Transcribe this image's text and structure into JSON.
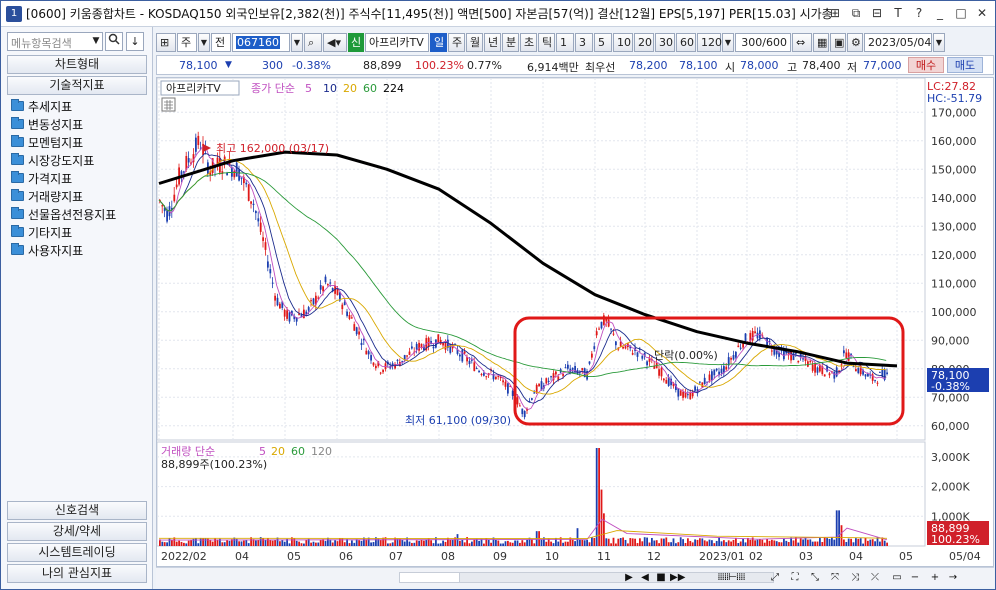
{
  "window": {
    "app_icon": "1",
    "title": "[0600] 키움종합차트 - KOSDAQ150 외국인보유[2,382(천)] 주식수[11,495(천)] 액면[500] 자본금[57(억)] 결산[12월] EPS[5,197] PER[15.03] 시가총",
    "buttons": [
      "⊞",
      "⧉",
      "⊟",
      "T",
      "?",
      "_",
      "□",
      "✕"
    ]
  },
  "left_panel": {
    "search_placeholder": "메뉴항목검색",
    "sections_top": [
      "차트형태",
      "기술적지표"
    ],
    "folders": [
      "추세지표",
      "변동성지표",
      "모멘텀지표",
      "시장강도지표",
      "가격지표",
      "거래량지표",
      "선물옵션전용지표",
      "기타지표",
      "사용자지표"
    ],
    "sections_bottom": [
      "신호검색",
      "강세/약세",
      "시스템트레이딩",
      "나의 관심지표"
    ]
  },
  "toolbar": {
    "type": "주",
    "prefix": "전",
    "code": "067160",
    "new_badge": "신",
    "name": "아프리카TV",
    "periods": [
      "일",
      "주",
      "월",
      "년",
      "분",
      "초",
      "틱"
    ],
    "active_period": "일",
    "intervals": [
      "1",
      "3",
      "5",
      "10",
      "20",
      "30",
      "60",
      "120"
    ],
    "count": "300/600",
    "date": "2023/05/04"
  },
  "quote": {
    "price": "78,100",
    "change": "300",
    "change_pct": "-0.38%",
    "volume": "88,899",
    "volume_ratio": "100.23%",
    "turnover": "0.77%",
    "amount": "6,914백만",
    "best_ask_label": "최우선",
    "best_ask": "78,200",
    "best_bid": "78,100",
    "open_label": "시",
    "open": "78,000",
    "high_label": "고",
    "high": "78,400",
    "low_label": "저",
    "low": "77,000",
    "buy": "매수",
    "sell": "매도"
  },
  "price_panel": {
    "title": "아프리카TV",
    "ma_label": "종가 단순",
    "ma_periods": [
      "5",
      "10",
      "20",
      "60",
      "224"
    ],
    "ma_colors": [
      "#c04fc0",
      "#1a2a8c",
      "#d9a800",
      "#2a9a3a",
      "#000000"
    ],
    "lc": "LC:27.82",
    "hc": "HC:-51.79",
    "y_ticks": [
      "170,000",
      "160,000",
      "150,000",
      "140,000",
      "130,000",
      "120,000",
      "110,000",
      "100,000",
      "90,000",
      "80,000",
      "70,000",
      "60,000"
    ],
    "current_price": "78,100",
    "current_change": "-0.38%",
    "high_annotation": "최고 162,000 (03/17)",
    "low_annotation": "최저 61,100 (09/30)",
    "mid_annotation": "단락(0.00%)"
  },
  "volume_panel": {
    "label": "거래량 단순",
    "ma_periods": [
      "5",
      "20",
      "60",
      "120"
    ],
    "ma_colors": [
      "#c04fc0",
      "#d9a800",
      "#2a9a3a",
      "#888888"
    ],
    "value": "88,899주(100.23%)",
    "y_ticks": [
      "3,000K",
      "2,000K",
      "1,000K"
    ],
    "current": "88,899",
    "current_pct": "100.23%"
  },
  "x_axis": [
    "2022/02",
    "04",
    "05",
    "06",
    "07",
    "08",
    "09",
    "10",
    "11",
    "12",
    "2023/01",
    "02",
    "03",
    "04",
    "05",
    "05/04"
  ],
  "chart_data": {
    "type": "line",
    "title": "아프리카TV",
    "x": [
      "2022/02",
      "04",
      "05",
      "06",
      "07",
      "08",
      "09",
      "10",
      "11",
      "12",
      "2023/01",
      "02",
      "03",
      "04",
      "05"
    ],
    "series": [
      {
        "name": "종가",
        "values": [
          140000,
          150000,
          105000,
          100000,
          83000,
          90000,
          72000,
          65000,
          93000,
          79000,
          74000,
          91000,
          81000,
          80000,
          78100
        ]
      },
      {
        "name": "224",
        "values": [
          145000,
          153000,
          156000,
          155000,
          150000,
          143000,
          131000,
          117000,
          106000,
          99000,
          93000,
          89000,
          86000,
          82000,
          81000
        ]
      }
    ],
    "ylim": [
      55000,
      175000
    ],
    "volume": {
      "name": "거래량",
      "peak": "3,300K",
      "ticks": [
        "3,000K",
        "2,000K",
        "1,000K"
      ]
    }
  }
}
